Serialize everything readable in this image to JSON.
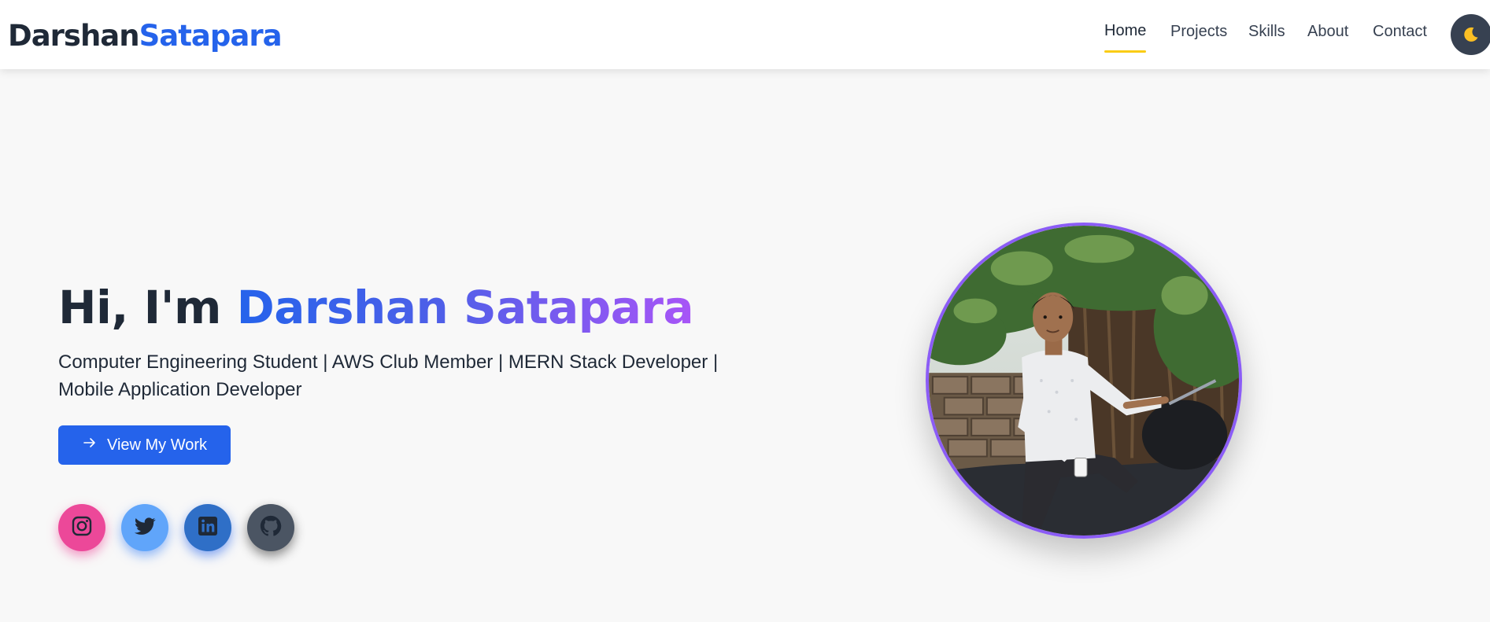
{
  "header": {
    "brand_first": "Darshan",
    "brand_last": "Satapara",
    "nav": [
      {
        "label": "Home",
        "active": true
      },
      {
        "label": "Projects",
        "active": false
      },
      {
        "label": "Skills",
        "active": false
      },
      {
        "label": "About",
        "active": false
      },
      {
        "label": "Contact",
        "active": false
      }
    ],
    "theme_toggle_icon": "moon-icon"
  },
  "hero": {
    "greeting": "Hi, I'm ",
    "name": "Darshan Satapara",
    "subtitle": "Computer Engineering Student | AWS Club Member | MERN Stack Developer | Mobile Application Developer",
    "cta_label": "View My Work",
    "cta_icon": "arrow-right-icon",
    "socials": [
      {
        "name": "instagram",
        "icon": "instagram-icon",
        "color": "#ec4899"
      },
      {
        "name": "twitter",
        "icon": "twitter-icon",
        "color": "#60a5fa"
      },
      {
        "name": "linkedin",
        "icon": "linkedin-icon",
        "color": "#2f6fc7"
      },
      {
        "name": "github",
        "icon": "github-icon",
        "color": "#4b5563"
      }
    ]
  },
  "colors": {
    "accent": "#2563eb",
    "gradient_end": "#a855f7",
    "nav_underline": "#facc15",
    "avatar_ring": "#8b5cf6"
  }
}
